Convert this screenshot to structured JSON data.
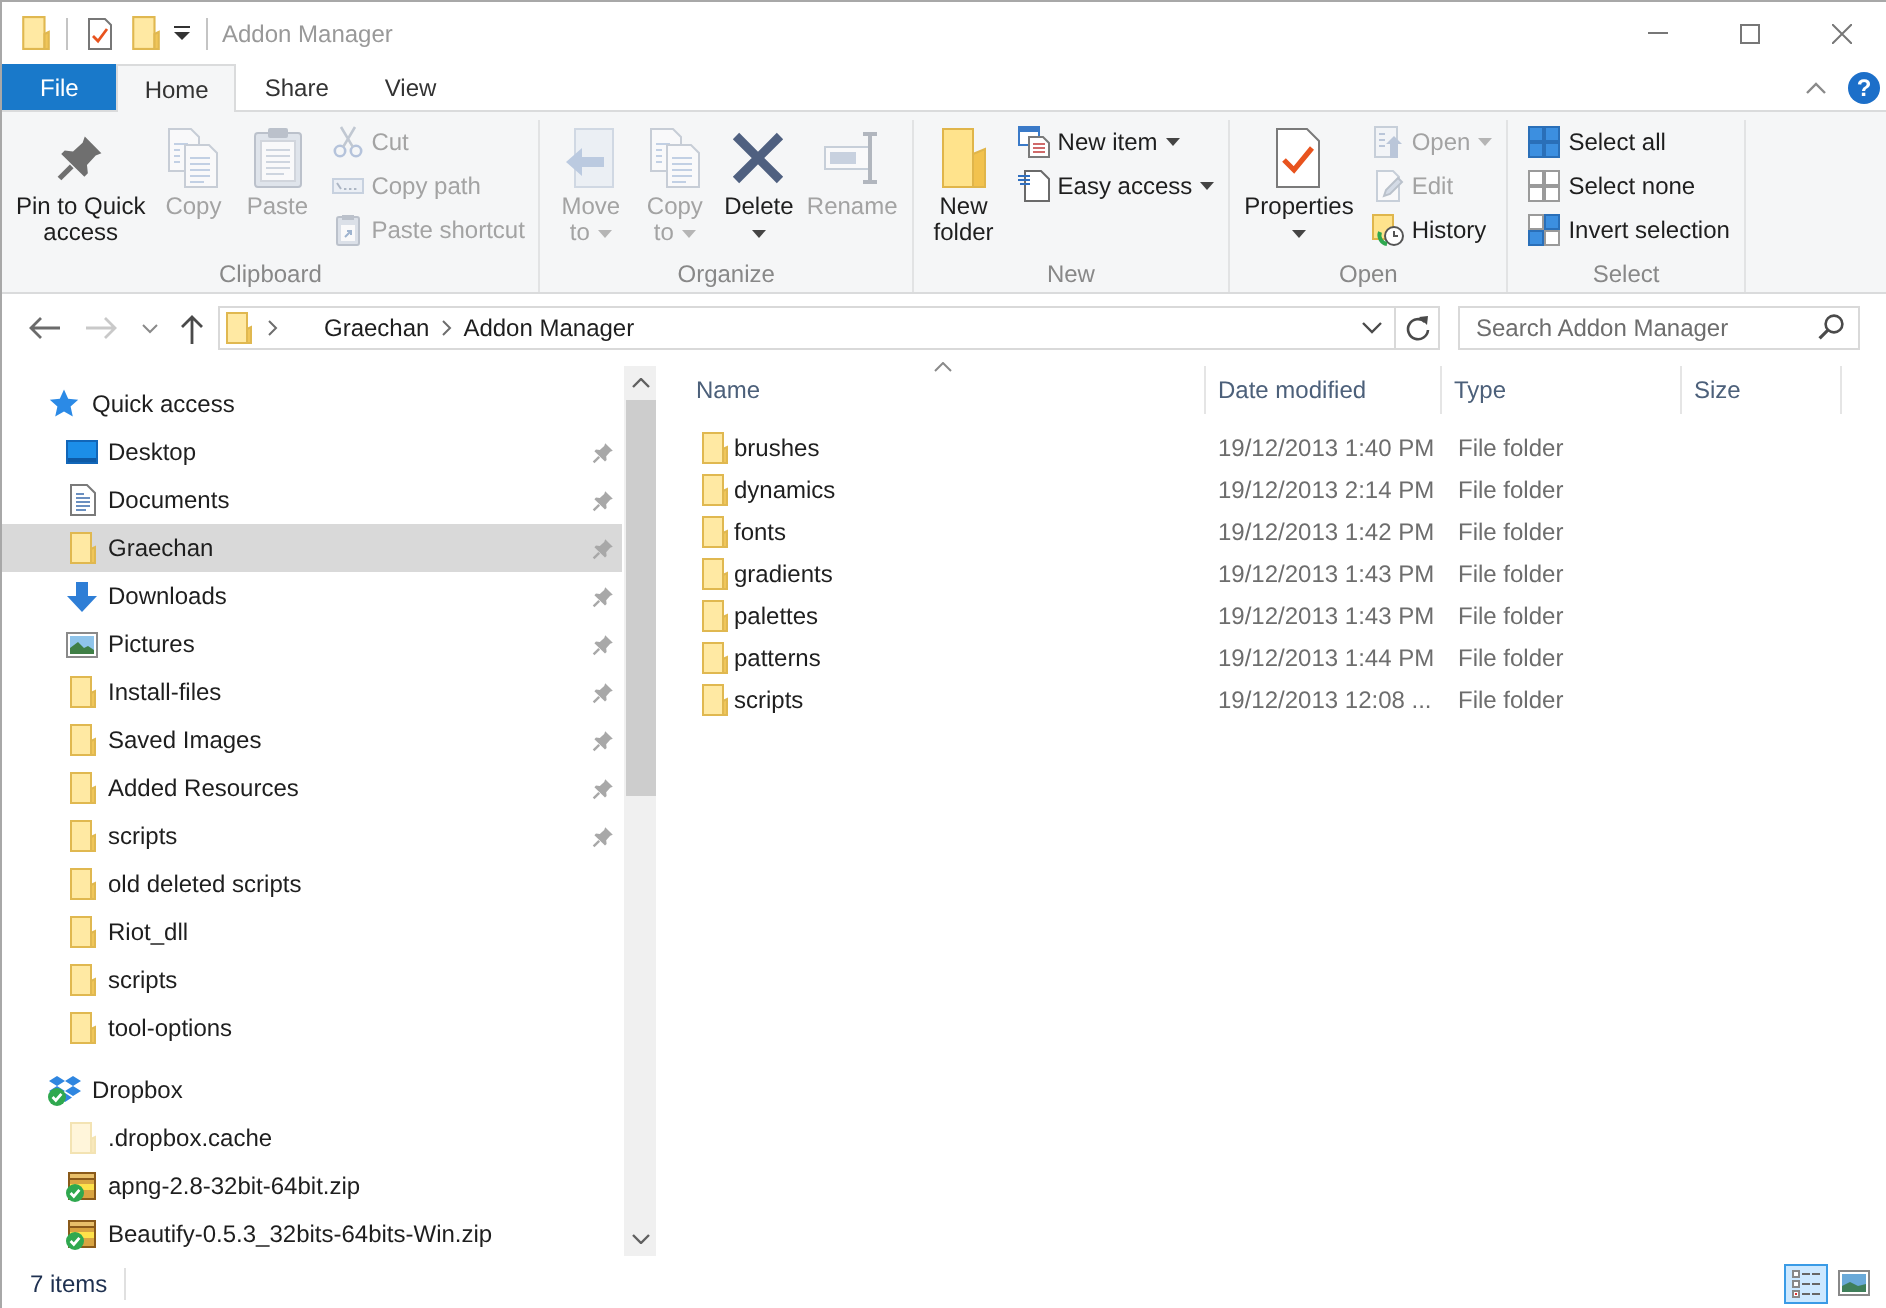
{
  "window": {
    "title": "Addon Manager"
  },
  "ribbon": {
    "tabs": [
      {
        "label": "File",
        "kind": "file",
        "selected": false
      },
      {
        "label": "Home",
        "kind": "tab",
        "selected": true
      },
      {
        "label": "Share",
        "kind": "tab",
        "selected": false
      },
      {
        "label": "View",
        "kind": "tab",
        "selected": false
      }
    ],
    "help": "?",
    "groups": [
      {
        "label": "Clipboard",
        "commands": [
          {
            "kind": "large",
            "label": "Pin to Quick access",
            "disabled": false,
            "dropdown": false
          },
          {
            "kind": "large",
            "label": "Copy",
            "disabled": true,
            "dropdown": false
          },
          {
            "kind": "large",
            "label": "Paste",
            "disabled": true,
            "dropdown": false
          },
          {
            "kind": "small",
            "label": "Cut",
            "disabled": true,
            "dropdown": false
          },
          {
            "kind": "small",
            "label": "Copy path",
            "disabled": true,
            "dropdown": false
          },
          {
            "kind": "small",
            "label": "Paste shortcut",
            "disabled": true,
            "dropdown": false
          }
        ]
      },
      {
        "label": "Organize",
        "commands": [
          {
            "kind": "large",
            "label": "Move to",
            "disabled": true,
            "dropdown": true
          },
          {
            "kind": "large",
            "label": "Copy to",
            "disabled": true,
            "dropdown": true
          },
          {
            "kind": "large",
            "label": "Delete",
            "disabled": false,
            "dropdown": true
          },
          {
            "kind": "large",
            "label": "Rename",
            "disabled": true,
            "dropdown": false
          }
        ]
      },
      {
        "label": "New",
        "commands": [
          {
            "kind": "large",
            "label": "New folder",
            "disabled": false,
            "dropdown": false
          },
          {
            "kind": "small",
            "label": "New item",
            "disabled": false,
            "dropdown": true
          },
          {
            "kind": "small",
            "label": "Easy access",
            "disabled": false,
            "dropdown": true
          }
        ]
      },
      {
        "label": "Open",
        "commands": [
          {
            "kind": "large",
            "label": "Properties",
            "disabled": false,
            "dropdown": true
          },
          {
            "kind": "small",
            "label": "Open",
            "disabled": true,
            "dropdown": true
          },
          {
            "kind": "small",
            "label": "Edit",
            "disabled": true,
            "dropdown": false
          },
          {
            "kind": "small",
            "label": "History",
            "disabled": false,
            "dropdown": false
          }
        ]
      },
      {
        "label": "Select",
        "commands": [
          {
            "kind": "small",
            "label": "Select all",
            "disabled": false,
            "dropdown": false
          },
          {
            "kind": "small",
            "label": "Select none",
            "disabled": false,
            "dropdown": false
          },
          {
            "kind": "small",
            "label": "Invert selection",
            "disabled": false,
            "dropdown": false
          }
        ]
      }
    ]
  },
  "nav_buttons": [
    {
      "kind": "back",
      "disabled": false
    },
    {
      "kind": "forward",
      "disabled": true
    },
    {
      "kind": "recent",
      "disabled": false
    },
    {
      "kind": "up",
      "disabled": false
    }
  ],
  "address_bar": {
    "crumbs": [
      "Graechan",
      "Addon Manager"
    ]
  },
  "search": {
    "placeholder": "Search Addon Manager"
  },
  "nav_pane": {
    "items": [
      {
        "label": "Quick access",
        "kind": "quick_access",
        "selected": false,
        "children": [
          {
            "label": "Desktop",
            "kind": "desktop",
            "pinned": true,
            "selected": false
          },
          {
            "label": "Documents",
            "kind": "documents",
            "pinned": true,
            "selected": false
          },
          {
            "label": "Graechan",
            "kind": "folder",
            "pinned": true,
            "selected": true
          },
          {
            "label": "Downloads",
            "kind": "downloads",
            "pinned": true,
            "selected": false
          },
          {
            "label": "Pictures",
            "kind": "pictures",
            "pinned": true,
            "selected": false
          },
          {
            "label": "Install-files",
            "kind": "folder",
            "pinned": true,
            "selected": false
          },
          {
            "label": "Saved Images",
            "kind": "folder",
            "pinned": true,
            "selected": false
          },
          {
            "label": "Added Resources",
            "kind": "folder",
            "pinned": true,
            "selected": false
          },
          {
            "label": "scripts",
            "kind": "folder",
            "pinned": true,
            "selected": false
          },
          {
            "label": "old deleted scripts",
            "kind": "folder",
            "pinned": false,
            "selected": false
          },
          {
            "label": "Riot_dll",
            "kind": "folder",
            "pinned": false,
            "selected": false
          },
          {
            "label": "scripts",
            "kind": "folder",
            "pinned": false,
            "selected": false
          },
          {
            "label": "tool-options",
            "kind": "folder",
            "pinned": false,
            "selected": false
          }
        ]
      },
      {
        "label": "Dropbox",
        "kind": "dropbox",
        "synced": true,
        "selected": false,
        "children": [
          {
            "label": ".dropbox.cache",
            "kind": "hidden_folder",
            "synced": false,
            "selected": false
          },
          {
            "label": "apng-2.8-32bit-64bit.zip",
            "kind": "archive",
            "synced": true,
            "selected": false
          },
          {
            "label": "Beautify-0.5.3_32bits-64bits-Win.zip",
            "kind": "archive",
            "synced": true,
            "selected": false
          }
        ]
      }
    ]
  },
  "file_list": {
    "columns": [
      {
        "label": "Name",
        "sorted": true
      },
      {
        "label": "Date modified",
        "sorted": false
      },
      {
        "label": "Type",
        "sorted": false
      },
      {
        "label": "Size",
        "sorted": false
      }
    ],
    "rows": [
      {
        "name": "brushes",
        "date_modified": "19/12/2013 1:40 PM",
        "type": "File folder",
        "selected": false
      },
      {
        "name": "dynamics",
        "date_modified": "19/12/2013 2:14 PM",
        "type": "File folder",
        "selected": false
      },
      {
        "name": "fonts",
        "date_modified": "19/12/2013 1:42 PM",
        "type": "File folder",
        "selected": false
      },
      {
        "name": "gradients",
        "date_modified": "19/12/2013 1:43 PM",
        "type": "File folder",
        "selected": false
      },
      {
        "name": "palettes",
        "date_modified": "19/12/2013 1:43 PM",
        "type": "File folder",
        "selected": false
      },
      {
        "name": "patterns",
        "date_modified": "19/12/2013 1:44 PM",
        "type": "File folder",
        "selected": false
      },
      {
        "name": "scripts",
        "date_modified": "19/12/2013 12:08 ...",
        "type": "File folder",
        "selected": false
      }
    ]
  },
  "status_bar": {
    "item_count": "7 items",
    "view_buttons": [
      {
        "kind": "details",
        "selected": true
      },
      {
        "kind": "large_icons",
        "selected": false
      }
    ]
  }
}
